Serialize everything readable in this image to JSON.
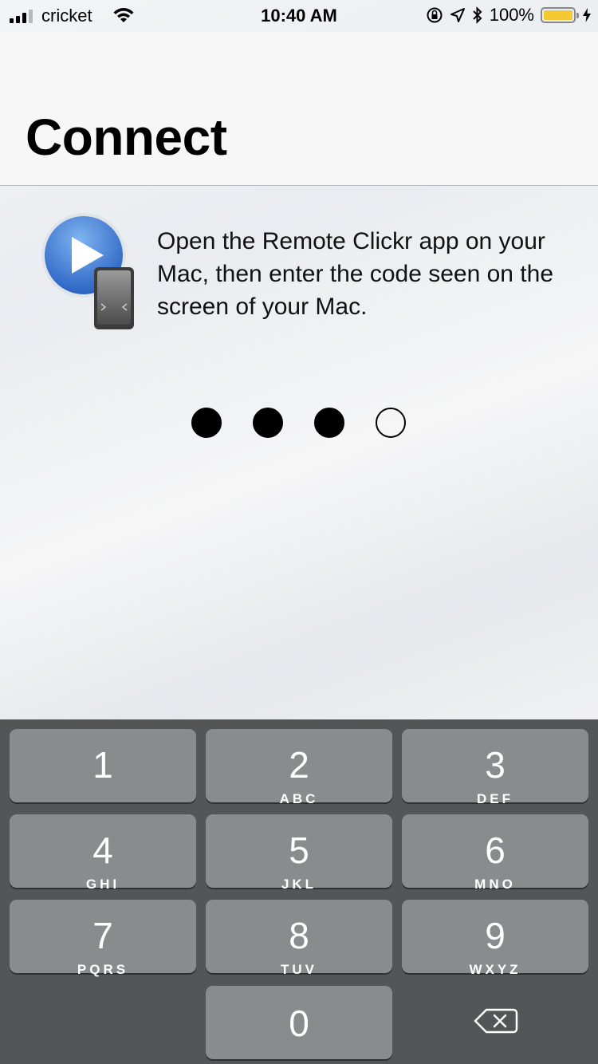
{
  "status_bar": {
    "carrier": "cricket",
    "time": "10:40 AM",
    "battery": "100%",
    "battery_color": "#f5c933"
  },
  "nav": {
    "title": "Connect"
  },
  "main": {
    "app_icon": "remote-clickr-app-icon",
    "instructions": "Open the Remote Clickr app on your Mac, then enter the code seen on the screen of your Mac.",
    "code_length": 4,
    "code_entered_count": 3
  },
  "keypad": {
    "keys": [
      {
        "num": "1",
        "letters": ""
      },
      {
        "num": "2",
        "letters": "ABC"
      },
      {
        "num": "3",
        "letters": "DEF"
      },
      {
        "num": "4",
        "letters": "GHI"
      },
      {
        "num": "5",
        "letters": "JKL"
      },
      {
        "num": "6",
        "letters": "MNO"
      },
      {
        "num": "7",
        "letters": "PQRS"
      },
      {
        "num": "8",
        "letters": "TUV"
      },
      {
        "num": "9",
        "letters": "WXYZ"
      },
      {
        "num": "0",
        "letters": ""
      }
    ],
    "delete_icon": "backspace-icon"
  }
}
